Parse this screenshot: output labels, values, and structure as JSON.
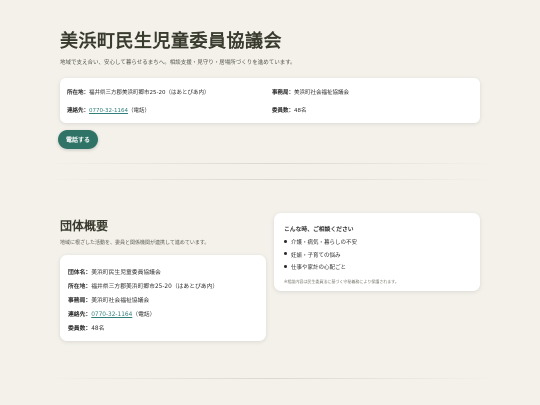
{
  "hero": {
    "title": "美浜町民生児童委員協議会",
    "lead": "地域で支え合い、安心して暮らせるまちへ。相談支援・見守り・居場所づくりを進めています。",
    "info": {
      "address_label": "所在地：",
      "address_value": "福井県三方郡美浜町郷市25-20（はあとぴあ内）",
      "office_label": "事務局：",
      "office_value": "美浜町社会福祉協議会",
      "contact_label": "連絡先：",
      "contact_tel": "0770-32-1164",
      "contact_suffix": "（電話）",
      "members_label": "委員数：",
      "members_value": "48名"
    },
    "call_button": "電話する"
  },
  "overview": {
    "title": "団体概要",
    "lead": "地域に根ざした活動を、委員と関係機関が連携して進めています。",
    "rows": {
      "name_label": "団体名：",
      "name_value": "美浜町民生児童委員協議会",
      "address_label": "所在地：",
      "address_value": "福井県三方郡美浜町郷市25-20（はあとぴあ内）",
      "office_label": "事務局：",
      "office_value": "美浜町社会福祉協議会",
      "contact_label": "連絡先：",
      "contact_tel": "0770-32-1164",
      "contact_suffix": "（電話）",
      "members_label": "委員数：",
      "members_value": "48名"
    }
  },
  "consult": {
    "title": "こんな時、ご相談ください",
    "items": [
      "介護・病気・暮らしの不安",
      "妊娠・子育ての悩み",
      "仕事や家計の心配ごと"
    ],
    "note": "※相談内容は民生委員法に基づく守秘義務により保護されます。"
  },
  "colors": {
    "background": "#f3f1ea",
    "accent": "#2f7366",
    "link": "#2f7f7a"
  }
}
